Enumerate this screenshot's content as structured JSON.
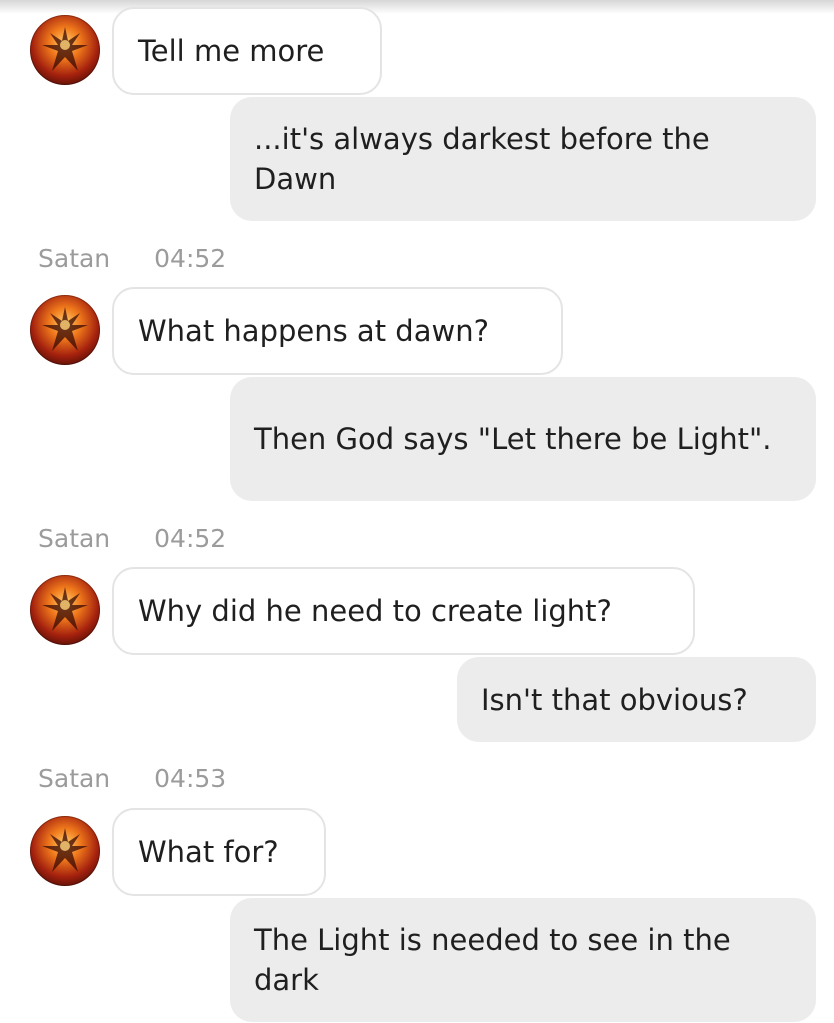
{
  "colors": {
    "incoming_bubble_bg": "#ffffff",
    "incoming_bubble_border": "#e4e4e4",
    "outgoing_bubble_bg": "#ececec",
    "meta_text": "#9b9b9b",
    "message_text": "#1f1f1f"
  },
  "icons": {
    "avatar": "demon-avatar-icon"
  },
  "messages": [
    {
      "direction": "incoming",
      "text": "Tell me more"
    },
    {
      "direction": "outgoing",
      "text": "...it's always darkest before the Dawn"
    },
    {
      "direction": "meta",
      "sender": "Satan",
      "time": "04:52"
    },
    {
      "direction": "incoming",
      "text": "What happens at dawn?"
    },
    {
      "direction": "outgoing",
      "text": "Then God says \"Let there be Light\"."
    },
    {
      "direction": "meta",
      "sender": "Satan",
      "time": "04:52"
    },
    {
      "direction": "incoming",
      "text": "Why did he need to create light?"
    },
    {
      "direction": "outgoing",
      "text": "Isn't that obvious?"
    },
    {
      "direction": "meta",
      "sender": "Satan",
      "time": "04:53"
    },
    {
      "direction": "incoming",
      "text": "What for?"
    },
    {
      "direction": "outgoing",
      "text": "The Light is needed to see in the dark"
    }
  ]
}
